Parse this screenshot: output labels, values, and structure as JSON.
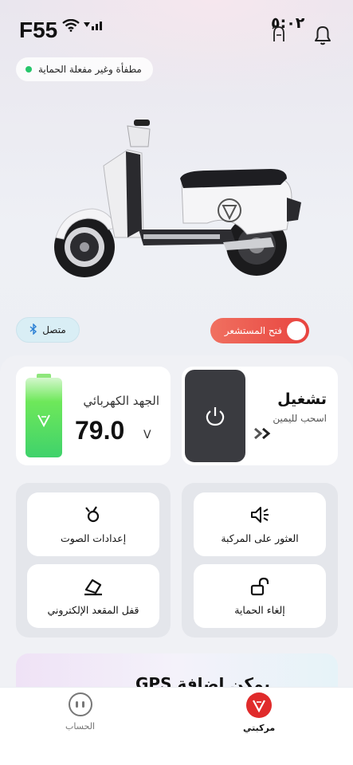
{
  "header": {
    "model_name": "F55",
    "time": "٥:٠٢",
    "helmet_icon": "helmet-icon",
    "notification_icon": "bell-icon"
  },
  "protection_status": {
    "text": "مطفأة وغير مفعلة الحماية",
    "dot_color": "#27c66b"
  },
  "connection": {
    "label": "متصل",
    "icon": "bluetooth-icon"
  },
  "sensor_toggle": {
    "label": "فتح المستشعر",
    "color": "#e8443f"
  },
  "voltage_card": {
    "label": "الجهد الكهربائي",
    "value": "79.0",
    "unit": "V"
  },
  "start_card": {
    "title": "تشغيل",
    "subtitle": "اسحب لليمين",
    "chevrons": "››",
    "power_icon": "power-icon"
  },
  "actions": {
    "find_vehicle": "العثور على المركبة",
    "sound_settings": "إعدادات الصوت",
    "disarm": "إلغاء الحماية",
    "seat_lock": "قفل المقعد الإلكتروني"
  },
  "gps_banner": {
    "text": "يمكن إضافة GPS"
  },
  "tabbar": {
    "account_label": "الحساب",
    "vehicle_label": "مركبتي"
  }
}
